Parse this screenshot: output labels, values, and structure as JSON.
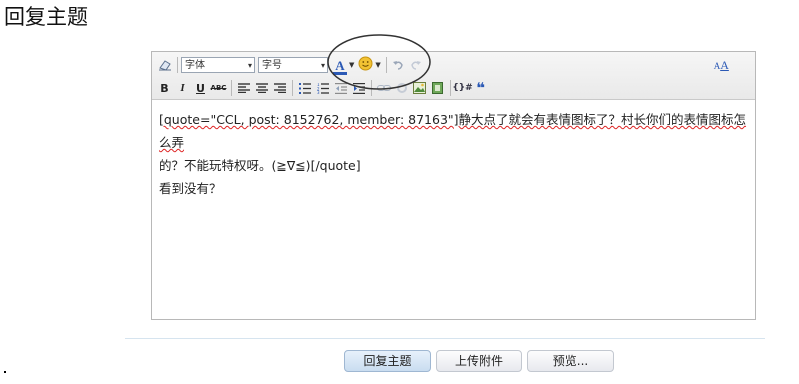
{
  "page": {
    "title": "回复主题"
  },
  "toolbar": {
    "font_family": {
      "value": "字体",
      "arrow": "▾"
    },
    "font_size": {
      "value": "字号",
      "arrow": "▾"
    },
    "font_color_glyph": "A",
    "bold": "B",
    "italic": "I",
    "underline": "U",
    "strike": "ABC",
    "special_chars": "{}#",
    "quote": "❝",
    "icons": {
      "eraser": "eraser-icon",
      "emoji": "smiley-icon",
      "undo": "undo-icon",
      "redo": "redo-icon",
      "font_size_toggle": "font-size-toggle-icon",
      "align_left": "align-left-icon",
      "align_center": "align-center-icon",
      "align_right": "align-right-icon",
      "unordered_list": "unordered-list-icon",
      "ordered_list": "ordered-list-icon",
      "outdent": "outdent-icon",
      "indent": "indent-icon",
      "link": "link-icon",
      "unlink": "unlink-icon",
      "image": "image-icon",
      "media": "media-icon"
    },
    "colors": {
      "accent": "#2b59b5",
      "emoji": "#f2c233"
    }
  },
  "editor": {
    "lines": [
      "[quote=\"CCL, post: 8152762, member: 87163\"]静大点了就会有表情图标了？村长你们的表情图标怎么弄",
      "的？不能玩特权呀。(≧∇≦)[/quote]",
      "看到没有？"
    ]
  },
  "buttons": {
    "reply": "回复主题",
    "upload": "上传附件",
    "preview": "预览..."
  }
}
